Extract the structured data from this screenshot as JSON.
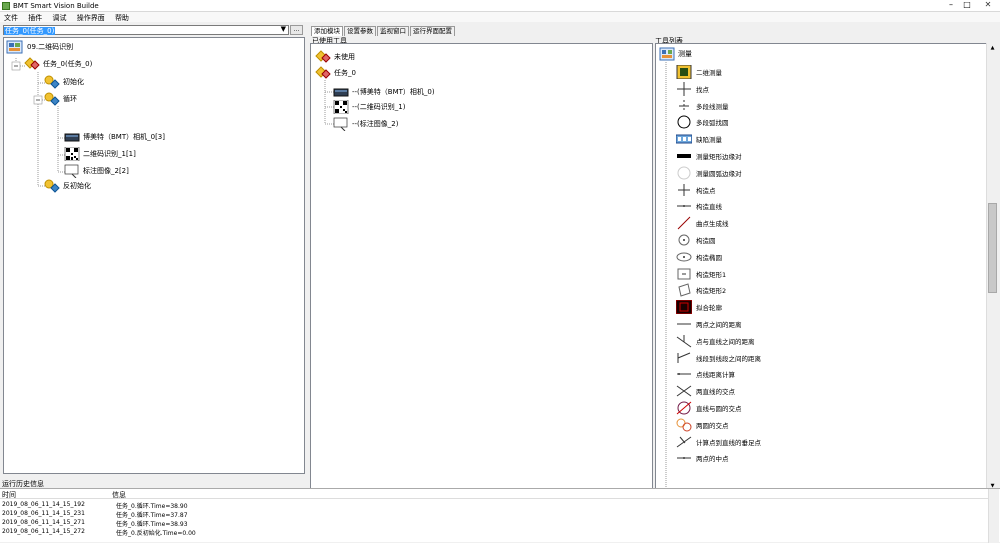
{
  "window": {
    "title": "BMT Smart Vision Builde",
    "minimize": "–",
    "maximize": "□",
    "close": "✕"
  },
  "menu": [
    "文件",
    "插件",
    "调试",
    "操作界面",
    "帮助"
  ],
  "left": {
    "combo_value": "任务_0(任务_0)",
    "browse_label": "...",
    "tree": [
      {
        "label": "09.二维码识别",
        "icon": "project-icon"
      },
      {
        "label": "任务_0(任务_0)",
        "icon": "task-icon"
      },
      {
        "label": "初始化",
        "icon": "init-icon"
      },
      {
        "label": "循环",
        "icon": "loop-icon"
      },
      {
        "label": "博美特（BMT）相机_0[3]",
        "icon": "camera-icon"
      },
      {
        "label": "二维码识别_1[1]",
        "icon": "qrcode-icon"
      },
      {
        "label": "标注图像_2[2]",
        "icon": "annotate-icon"
      },
      {
        "label": "反初始化",
        "icon": "deinit-icon"
      }
    ]
  },
  "right": {
    "tabs": [
      "添加模块",
      "设置参数",
      "监视窗口",
      "运行界面配置"
    ],
    "used_tools_label": "已使用工具",
    "tool_list_label": "工具列表",
    "used_tree": [
      {
        "label": "未使用"
      },
      {
        "label": "任务_0"
      },
      {
        "label": "--(博美特（BMT）相机_0)"
      },
      {
        "label": "--(二维码识别_1)"
      },
      {
        "label": "--(标注图像_2)"
      }
    ],
    "library_header": "测量",
    "library": [
      "二维测量",
      "找点",
      "多段线测量",
      "多段弧找圆",
      "缺陷测量",
      "测量矩形边缘对",
      "测量圆弧边缘对",
      "构造点",
      "构造直线",
      "曲点生成线",
      "构造圆",
      "构造椭圆",
      "构造矩形1",
      "构造矩形2",
      "拟合轮廓",
      "两点之间的距离",
      "点与直线之间的距离",
      "线段到线段之间的距离",
      "点线距离计算",
      "两直线的交点",
      "直线与圆的交点",
      "两圆的交点",
      "计算点到直线的垂足点",
      "两点的中点"
    ]
  },
  "history": {
    "title": "运行历史信息",
    "col_time": "时间",
    "col_info": "信息",
    "rows": [
      {
        "time": "2019_08_06_11_14_15_192",
        "info": "任务_0.循环.Time=38.90"
      },
      {
        "time": "2019_08_06_11_14_15_231",
        "info": "任务_0.循环.Time=37.87"
      },
      {
        "time": "2019_08_06_11_14_15_271",
        "info": "任务_0.循环.Time=38.93"
      },
      {
        "time": "2019_08_06_11_14_15_272",
        "info": "任务_0.反初始化.Time=0.00"
      }
    ]
  }
}
